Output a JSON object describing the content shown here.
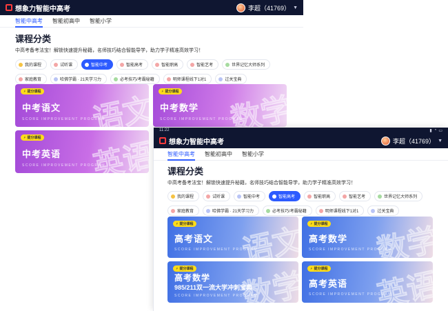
{
  "app": {
    "brand": "想象力智能中高考",
    "user_name": "李超（41769）"
  },
  "status_bar": {
    "time": "11:22"
  },
  "tabs": [
    "智能中高考",
    "智能初高中",
    "智能小学"
  ],
  "section": {
    "title": "课程分类",
    "description": "中高考备考法宝！解锁快速提升秘籍，名师技巧结合智能导学，助力学子精准高效学习！"
  },
  "screen_a": {
    "chips": [
      {
        "label": "我的课程",
        "dot": "#f6c343",
        "active": false
      },
      {
        "label": "试听课",
        "dot": "#f3a6a6",
        "active": false
      },
      {
        "label": "智能中考",
        "dot": "#ffffff",
        "active": true
      },
      {
        "label": "智能高考",
        "dot": "#f3a6a6",
        "active": false
      },
      {
        "label": "智能职高",
        "dot": "#f3a6a6",
        "active": false
      },
      {
        "label": "智能艺考",
        "dot": "#f3a6a6",
        "active": false
      },
      {
        "label": "世界记忆大师系列",
        "dot": "#a6dba0",
        "active": false
      },
      {
        "label": "家庭教育",
        "dot": "#f3a6a6",
        "active": false
      },
      {
        "label": "哈佛学霸 · 21天学习力",
        "dot": "#b9c4f5",
        "active": false
      },
      {
        "label": "必考技巧/考霸秘籍",
        "dot": "#a6dba0",
        "active": false
      },
      {
        "label": "明师课程线下1对1",
        "dot": "#f3a6a6",
        "active": false
      },
      {
        "label": "过关宝典",
        "dot": "#b9c4f5",
        "active": false
      }
    ],
    "cards": [
      {
        "badge": "提分课程",
        "title": "中考语文",
        "subtitle": "",
        "english": "SCORE IMPROVEMENT PROGRAM",
        "watermark": "语文"
      },
      {
        "badge": "提分课程",
        "title": "中考数学",
        "subtitle": "",
        "english": "SCORE IMPROVEMENT PROGRAM",
        "watermark": "数学"
      },
      {
        "badge": "提分课程",
        "title": "中考英语",
        "subtitle": "",
        "english": "SCORE IMPROVEMENT PROGRAM",
        "watermark": "英语"
      }
    ]
  },
  "screen_b": {
    "chips": [
      {
        "label": "我的课程",
        "dot": "#f6c343",
        "active": false
      },
      {
        "label": "试听课",
        "dot": "#f3a6a6",
        "active": false
      },
      {
        "label": "智能中考",
        "dot": "#b9c4f5",
        "active": false
      },
      {
        "label": "智能高考",
        "dot": "#ffffff",
        "active": true
      },
      {
        "label": "智能职高",
        "dot": "#f3a6a6",
        "active": false
      },
      {
        "label": "智能艺考",
        "dot": "#f3a6a6",
        "active": false
      },
      {
        "label": "世界记忆大师系列",
        "dot": "#a6dba0",
        "active": false
      },
      {
        "label": "家庭教育",
        "dot": "#f3a6a6",
        "active": false
      },
      {
        "label": "哈佛学霸 · 21天学习力",
        "dot": "#b9c4f5",
        "active": false
      },
      {
        "label": "必考技巧/考霸秘籍",
        "dot": "#a6dba0",
        "active": false
      },
      {
        "label": "明师课程线下1对1",
        "dot": "#f3a6a6",
        "active": false
      },
      {
        "label": "过关宝典",
        "dot": "#b9c4f5",
        "active": false
      }
    ],
    "cards": [
      {
        "badge": "提分课程",
        "title": "高考语文",
        "subtitle": "",
        "english": "SCORE IMPROVEMENT PROGRAM",
        "watermark": "语文"
      },
      {
        "badge": "提分课程",
        "title": "高考数学",
        "subtitle": "",
        "english": "SCORE IMPROVEMENT PROGRAM",
        "watermark": "数学"
      },
      {
        "badge": "提分课程",
        "title": "高考数学",
        "subtitle": "985/211双一流大学冲刺宝典",
        "english": "SCORE IMPROVEMENT PROGRAM",
        "watermark": "数学"
      },
      {
        "badge": "提分课程",
        "title": "高考英语",
        "subtitle": "",
        "english": "SCORE IMPROVEMENT PROGRAM",
        "watermark": "英语"
      }
    ]
  },
  "colors": {
    "topbar": "#0f1631",
    "accent": "#2d5bff",
    "badge": "#ffdd1a",
    "logo": "#ff3b3b"
  },
  "icons": [
    "logo-icon",
    "avatar",
    "caret-down-icon",
    "bolt-icon"
  ]
}
